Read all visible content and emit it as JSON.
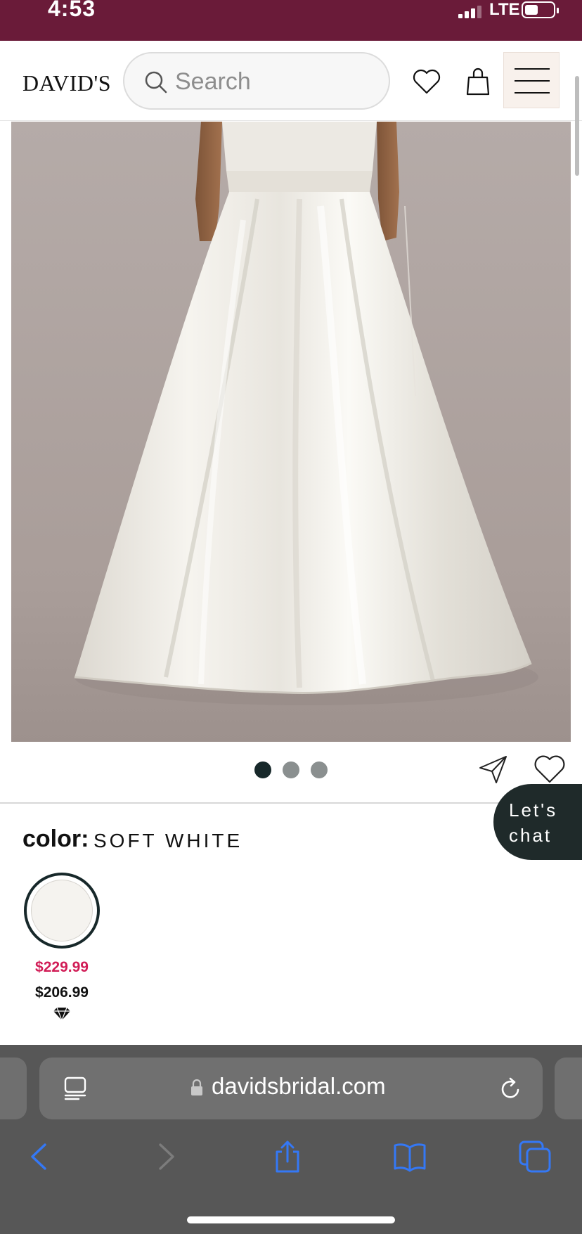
{
  "status_bar": {
    "time": "4:53",
    "network": "LTE",
    "signal_bars": 3,
    "battery_level": 0.4
  },
  "header": {
    "logo": "DAVID'S",
    "search": {
      "placeholder": "Search",
      "value": ""
    },
    "icons": [
      "heart-icon",
      "bag-icon",
      "hamburger-menu-icon"
    ]
  },
  "product": {
    "image_alt": "Soft white satin A-line wedding gown with pockets",
    "carousel": {
      "count": 3,
      "active_index": 0
    },
    "actions": [
      "share-icon",
      "wishlist-heart-icon"
    ]
  },
  "chat": {
    "line1": "Let's",
    "line2": "chat"
  },
  "color": {
    "label": "color:",
    "value": "SOFT WHITE",
    "swatches": [
      {
        "name": "soft white",
        "hex": "#f5f3ef",
        "original_price": "$229.99",
        "sale_price": "$206.99"
      }
    ]
  },
  "browser": {
    "url": "davidsbridal.com",
    "secure": true,
    "toolbar": [
      "back-icon",
      "forward-icon",
      "share-icon",
      "bookmarks-icon",
      "tabs-icon"
    ]
  },
  "colors": {
    "status_bar_bg": "#6a1b39",
    "accent_price": "#d11c56",
    "dark_teal": "#17282a",
    "ios_blue": "#3478f6",
    "browser_bg": "#575757"
  }
}
